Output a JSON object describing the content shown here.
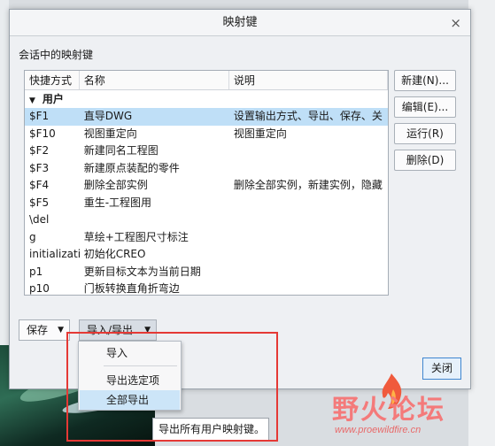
{
  "dialog": {
    "title": "映射键",
    "close_glyph": "×",
    "section_label": "会话中的映射键"
  },
  "list": {
    "columns": [
      "快捷方式",
      "名称",
      "说明"
    ],
    "group": {
      "label": "用户",
      "toggle_glyph": "▼"
    },
    "rows": [
      {
        "key": "$F1",
        "name": "直导DWG",
        "desc": "设置输出方式、导出、保存、关",
        "selected": true
      },
      {
        "key": "$F10",
        "name": "视图重定向",
        "desc": "视图重定向"
      },
      {
        "key": "$F2",
        "name": "新建同名工程图",
        "desc": ""
      },
      {
        "key": "$F3",
        "name": "新建原点装配的零件",
        "desc": ""
      },
      {
        "key": "$F4",
        "name": "删除全部实例",
        "desc": "删除全部实例，新建实例，隐藏"
      },
      {
        "key": "$F5",
        "name": "重生-工程图用",
        "desc": ""
      },
      {
        "key": "\\del",
        "name": "",
        "desc": ""
      },
      {
        "key": "g",
        "name": "草绘+工程图尺寸标注",
        "desc": ""
      },
      {
        "key": "initialization",
        "name": "初始化CREO",
        "desc": ""
      },
      {
        "key": "p1",
        "name": "更新目标文本为当前日期",
        "desc": ""
      },
      {
        "key": "p10",
        "name": "门板转换直角折弯边",
        "desc": ""
      }
    ]
  },
  "side_buttons": [
    "新建(N)...",
    "编辑(E)...",
    "运行(R)",
    "删除(D)"
  ],
  "bottom": {
    "save_label": "保存",
    "import_export_label": "导入/导出",
    "dropdown_glyph": "▼",
    "ok_label": "关闭"
  },
  "menu": {
    "items": [
      "导入",
      "导出选定项",
      "全部导出"
    ],
    "hovered": "全部导出"
  },
  "tooltip": "导出所有用户映射键。",
  "watermark": {
    "text": "野火论坛",
    "url": "www.proewildfire.cn"
  },
  "colors": {
    "selection": "#bfdff7",
    "menu_hover": "#cce5f8",
    "highlight_box": "#e53935",
    "watermark": "#f47a7a"
  }
}
